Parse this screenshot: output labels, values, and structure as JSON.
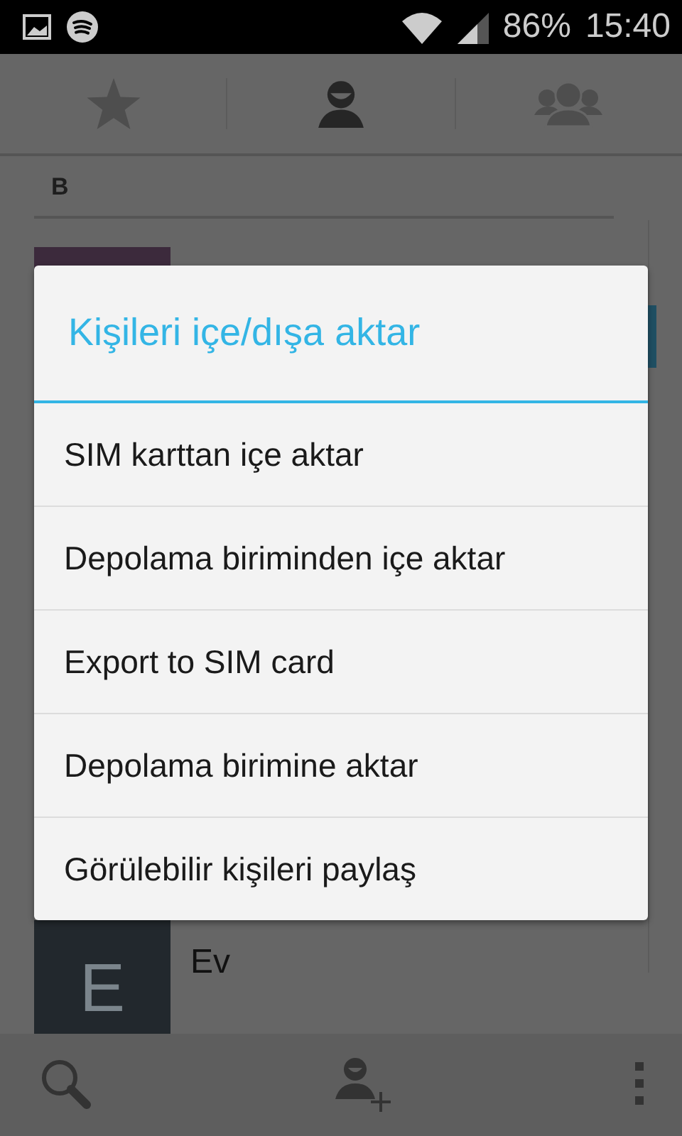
{
  "status_bar": {
    "battery": "86%",
    "time": "15:40"
  },
  "tabs": [
    {
      "kind": "star",
      "selected": false
    },
    {
      "kind": "person",
      "selected": true
    },
    {
      "kind": "group",
      "selected": false
    }
  ],
  "section_header": "B",
  "contacts": [
    {
      "kind": "color"
    },
    {
      "kind": "letter",
      "initial": "E",
      "name": "Ev"
    }
  ],
  "dialog": {
    "title": "Kişileri içe/dışa aktar",
    "items": [
      "SIM karttan içe aktar",
      "Depolama biriminden içe aktar",
      "Export to SIM card",
      "Depolama birimine aktar",
      "Görülebilir kişileri paylaş"
    ]
  }
}
